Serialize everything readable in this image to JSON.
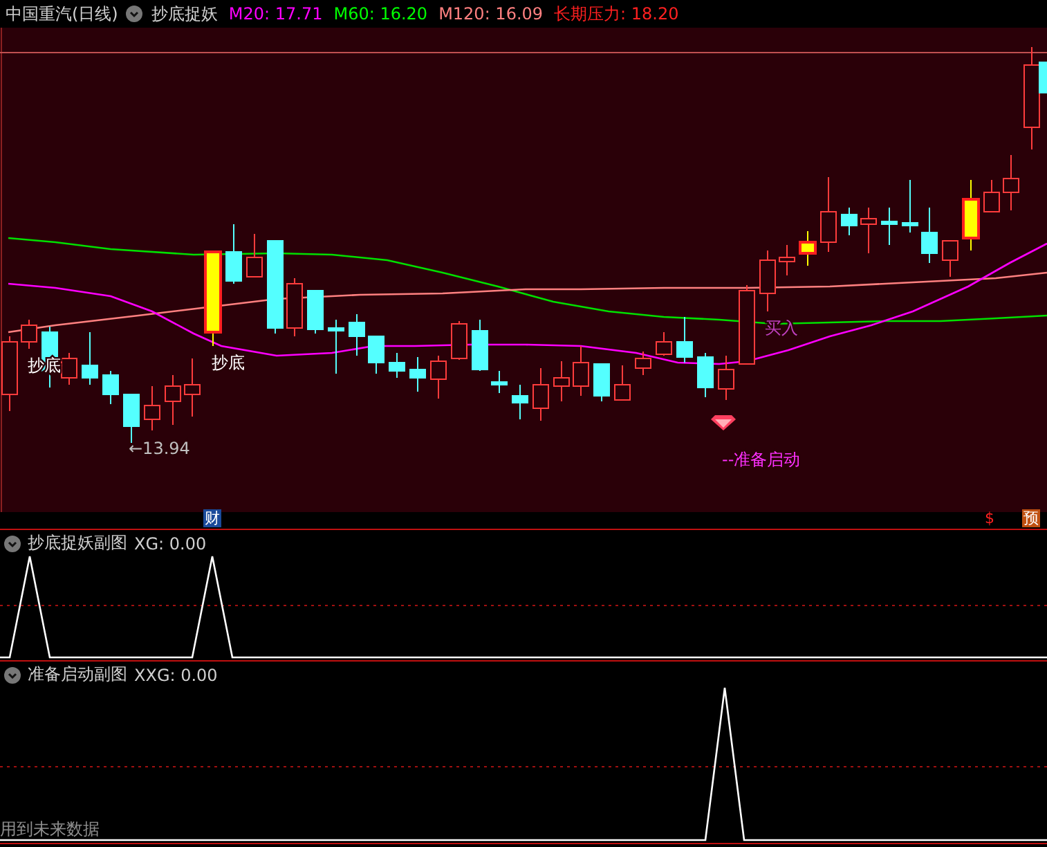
{
  "header": {
    "title": "中国重汽(日线)",
    "indicator": "抄底捉妖",
    "legend": [
      {
        "label": "M20: 17.71",
        "color": "#ff00ff"
      },
      {
        "label": "M60: 16.20",
        "color": "#00ff00"
      },
      {
        "label": "M120: 16.09",
        "color": "#ff8080"
      },
      {
        "label": "长期压力: 18.20",
        "color": "#ff2020"
      }
    ]
  },
  "main_chart": {
    "annotations": [
      {
        "kind": "signal",
        "text": "抄底"
      },
      {
        "kind": "signal",
        "text": "抄底"
      },
      {
        "kind": "low",
        "text": "←13.94"
      },
      {
        "kind": "buy",
        "text": "买入"
      },
      {
        "kind": "start",
        "text": "--准备启动"
      }
    ]
  },
  "markers": [
    {
      "kind": "finance",
      "text": "财"
    },
    {
      "kind": "dollar",
      "text": "$"
    },
    {
      "kind": "forecast",
      "text": "预"
    }
  ],
  "sub_panels": [
    {
      "title": "抄底捉妖副图",
      "reading": "XG: 0.00"
    },
    {
      "title": "准备启动副图",
      "reading": "XXG: 0.00",
      "note": "用到未来数据"
    }
  ]
}
